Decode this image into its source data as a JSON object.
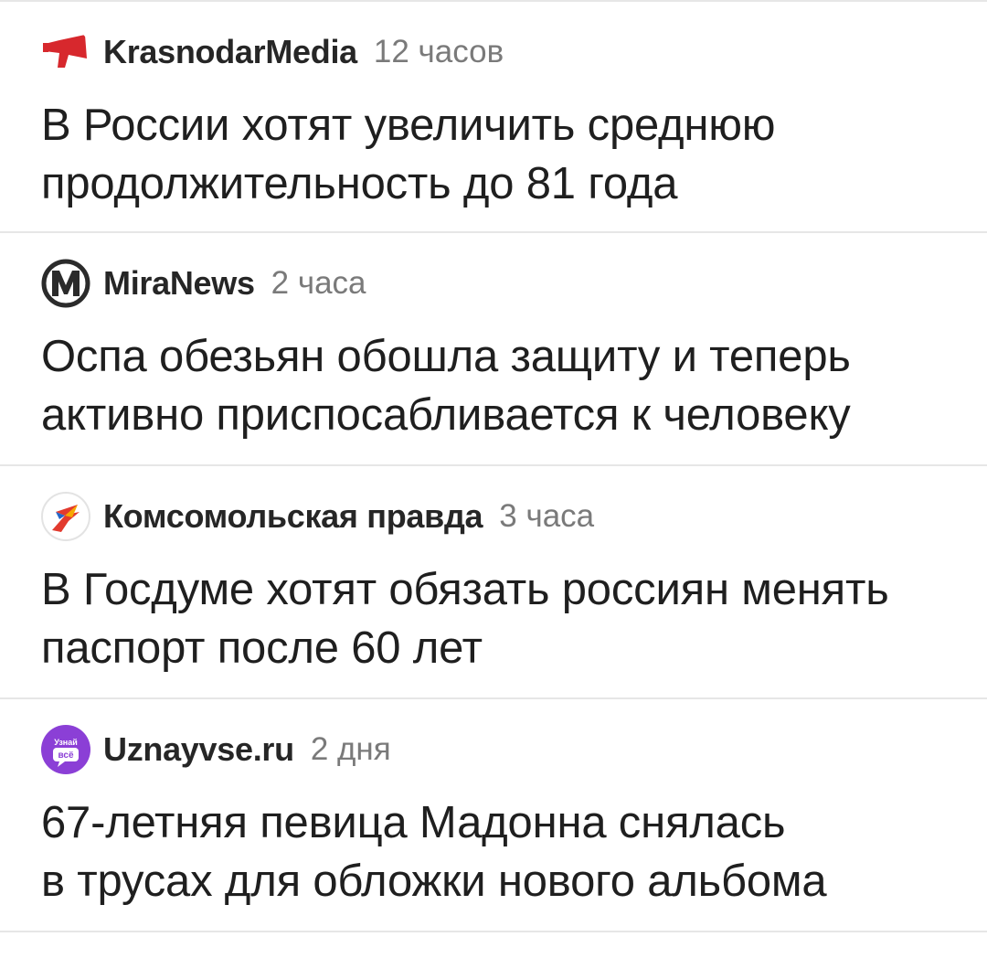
{
  "feed": {
    "items": [
      {
        "source": "KrasnodarMedia",
        "time": "12 часов",
        "logo_icon": "red-megaphone-icon",
        "headline_lines": [
          "В России хотят увеличить среднюю",
          "продолжительность до 81 года"
        ]
      },
      {
        "source": "MiraNews",
        "time": "2 часа",
        "logo_icon": "letter-m-icon",
        "headline_lines": [
          "Оспа обезьян обошла защиту и теперь",
          "активно приспосабливается к человеку"
        ]
      },
      {
        "source": "Комсомольская правда",
        "time": "3 часа",
        "logo_icon": "swallow-bird-icon",
        "headline_lines": [
          "В Госдуме хотят обязать россиян менять",
          "паспорт после 60 лет"
        ]
      },
      {
        "source": "Uznayvse.ru",
        "time": "2 дня",
        "logo_icon": "speech-bubble-icon",
        "logo_text": [
          "Узнай",
          "всё"
        ],
        "headline_lines": [
          "67-летняя певица Мадонна снялась",
          "в трусах для обложки нового альбома"
        ]
      }
    ]
  }
}
